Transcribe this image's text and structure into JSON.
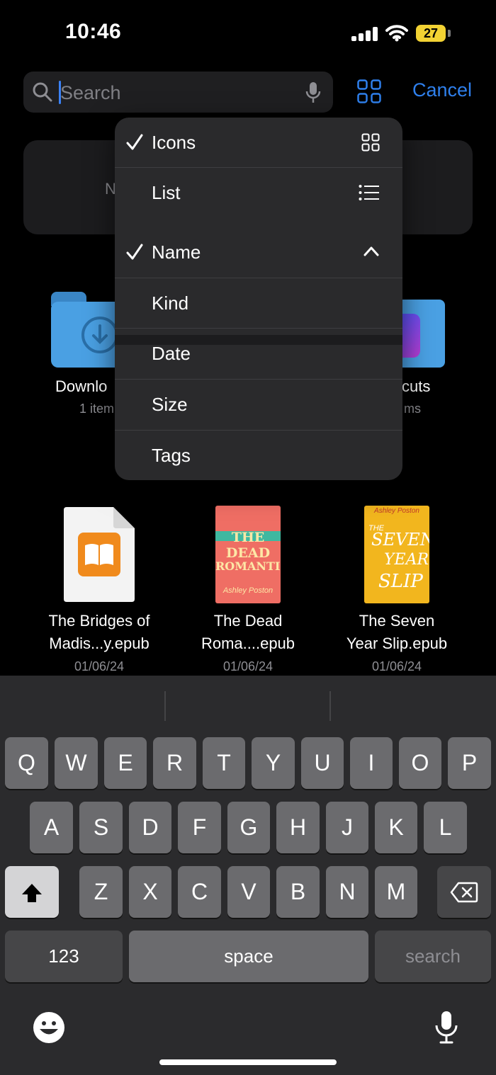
{
  "status": {
    "time": "10:46",
    "battery": "27"
  },
  "search": {
    "placeholder": "Search",
    "cancel": "Cancel"
  },
  "background": {
    "card_initial": "N",
    "folders": [
      {
        "label": "Downlo",
        "sub": "1 item"
      },
      {
        "label": "cuts",
        "sub": "ms"
      }
    ],
    "files": [
      {
        "line1": "The Bridges of",
        "line2": "Madis...y.epub",
        "date": "01/06/24"
      },
      {
        "line1": "The Dead",
        "line2": "Roma....epub",
        "date": "01/06/24"
      },
      {
        "line1": "The Seven",
        "line2": "Year Slip.epub",
        "date": "01/06/24"
      }
    ],
    "covers": {
      "dead_romantics": {
        "title1": "THE DEAD",
        "title2": "ROMANTICS",
        "author": "Ashley Poston"
      },
      "seven_year_slip": {
        "title1": "THE",
        "title2": "SEVEN",
        "title3": "YEAR",
        "title4": "SLIP",
        "author": "Ashley Poston"
      }
    }
  },
  "menu": {
    "view_items": [
      {
        "label": "Icons",
        "checked": true,
        "icon": "grid-icon"
      },
      {
        "label": "List",
        "checked": false,
        "icon": "list-icon"
      }
    ],
    "sort_items": [
      {
        "label": "Name",
        "checked": true,
        "icon": "chevron-up-icon"
      },
      {
        "label": "Kind"
      },
      {
        "label": "Date"
      },
      {
        "label": "Size"
      },
      {
        "label": "Tags"
      }
    ]
  },
  "keyboard": {
    "row1": [
      "Q",
      "W",
      "E",
      "R",
      "T",
      "Y",
      "U",
      "I",
      "O",
      "P"
    ],
    "row2": [
      "A",
      "S",
      "D",
      "F",
      "G",
      "H",
      "J",
      "K",
      "L"
    ],
    "row3": [
      "Z",
      "X",
      "C",
      "V",
      "B",
      "N",
      "M"
    ],
    "numbers": "123",
    "space": "space",
    "search": "search"
  },
  "colors": {
    "accent": "#2f80ed",
    "battery": "#f2d233",
    "folder": "#4aa0e3"
  }
}
